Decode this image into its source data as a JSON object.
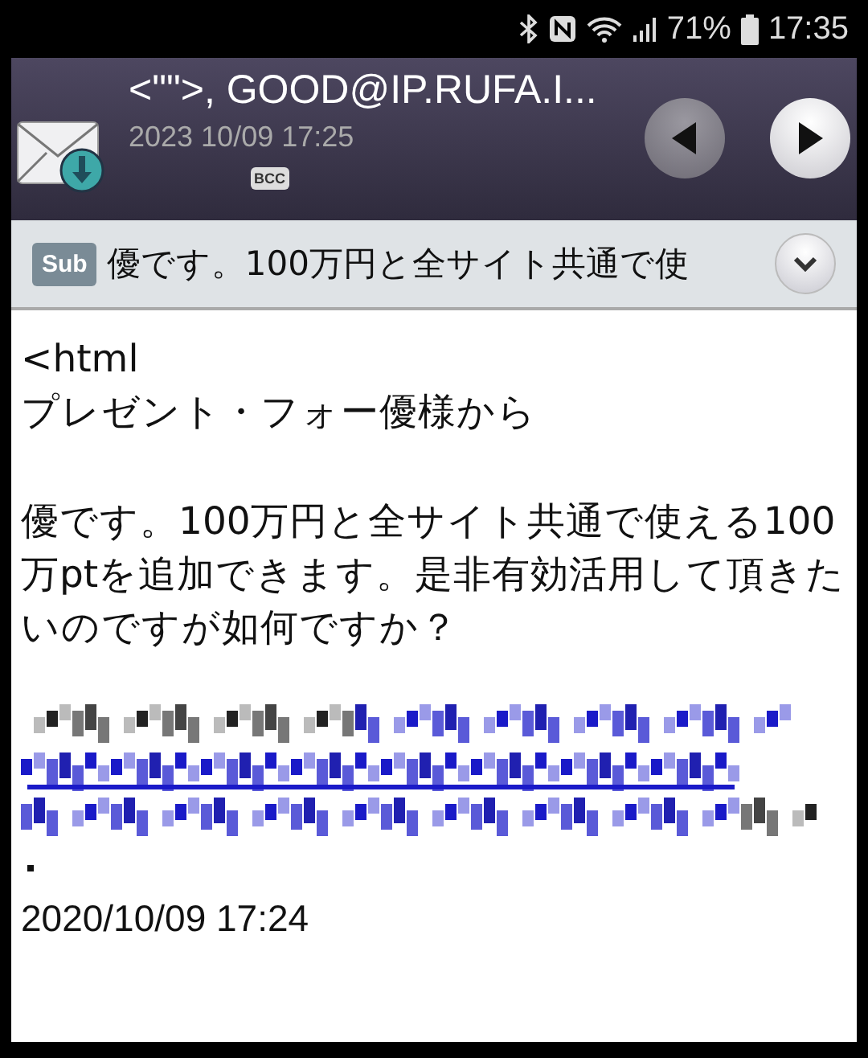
{
  "status_bar": {
    "battery": "71%",
    "time": "17:35"
  },
  "header": {
    "sender": "<\"\">, GOOD@IP.RUFA.I...",
    "date": "2023 10/09 17:25",
    "bcc": "BCC"
  },
  "subject": {
    "badge": "Sub",
    "text": "優です。100万円と全サイト共通で使"
  },
  "body": {
    "paragraphs": [
      "<html\nプレゼント・フォー優様から",
      "優です。100万円と全サイト共通で使える100万ptを追加できます。是非有効活用して頂きたいのですが如何ですか？"
    ],
    "footer_date": "2020/10/09 17:24"
  }
}
